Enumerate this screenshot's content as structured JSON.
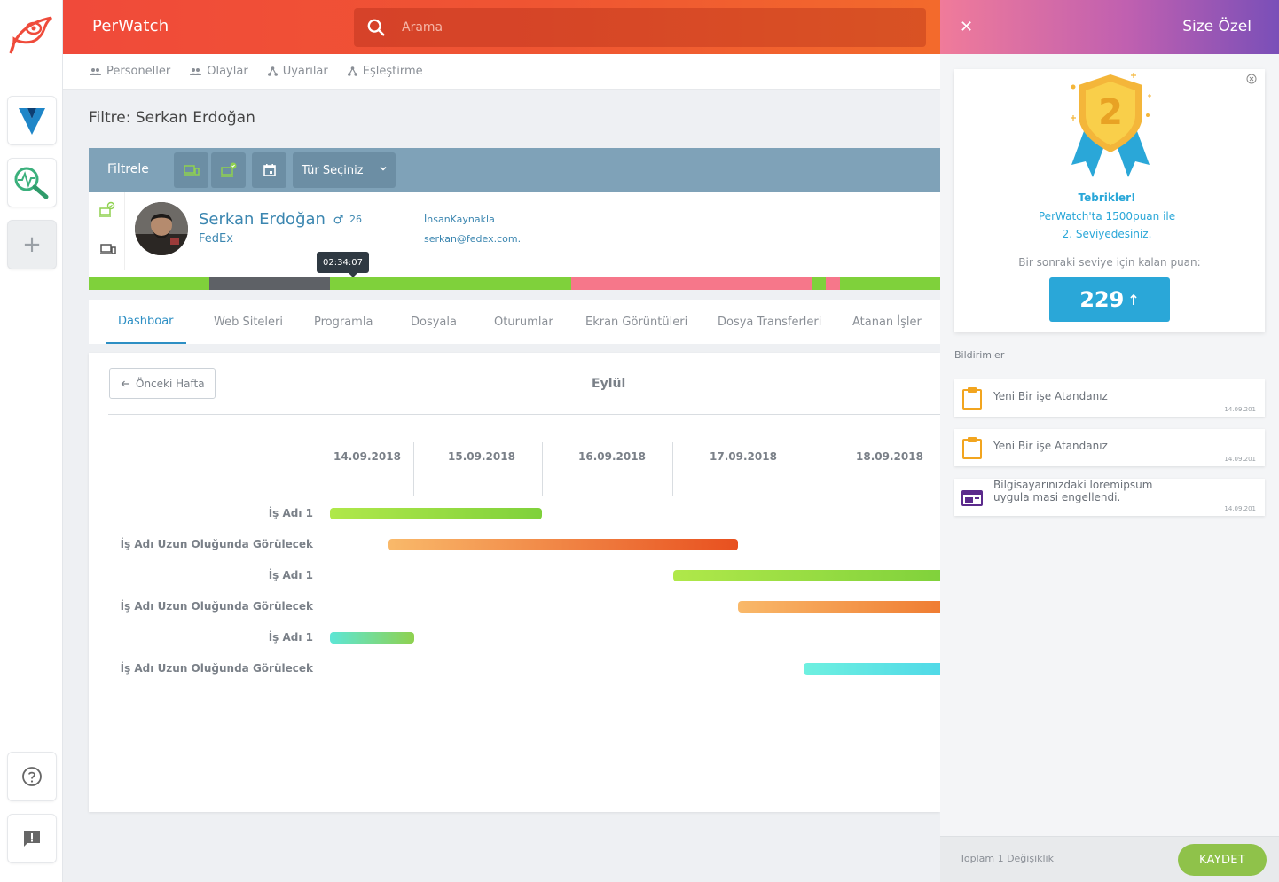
{
  "header": {
    "brand": "PerWatch",
    "search_placeholder": "Arama"
  },
  "subnav": {
    "items": [
      "Personeller",
      "Olaylar",
      "Uyarılar",
      "Eşleştirme"
    ]
  },
  "filter_title": "Filtre: Serkan Erdoğan",
  "filter_bar": {
    "label": "Filtrele",
    "type_select": "Tür Seçiniz"
  },
  "profile": {
    "name": "Serkan Erdoğan",
    "company": "FedEx",
    "age": "26",
    "department": "İnsanKaynakla",
    "email": "serkan@fedex.com.",
    "tooltip": "02:34:07"
  },
  "tabs": [
    "Dashboar",
    "Web Siteleri",
    "Programla",
    "Dosyala",
    "Oturumlar",
    "Ekran Görüntüleri",
    "Dosya Transferleri",
    "Atanan İşler"
  ],
  "dashboard": {
    "prev_button": "Önceki Hafta",
    "month": "Eylül",
    "dates": [
      "14.09.2018",
      "15.09.2018",
      "16.09.2018",
      "17.09.2018",
      "18.09.2018"
    ],
    "tasks": [
      {
        "label": "İş Adı 1"
      },
      {
        "label": "İş Adı Uzun Oluğunda Görülecek"
      },
      {
        "label": "İş Adı 1"
      },
      {
        "label": "İş Adı Uzun Oluğunda Görülecek"
      },
      {
        "label": "İş Adı 1"
      },
      {
        "label": "İş Adı Uzun Oluğunda Görülecek"
      }
    ]
  },
  "colors": {
    "header_red": "#f04a3a",
    "accent_blue": "#2aa7d8",
    "green": "#8fc24a",
    "timeline_pink": "#f6778a"
  },
  "right_panel": {
    "title": "Size Özel",
    "badge_level": "2",
    "congrats": "Tebrikler!",
    "points_line": "PerWatch'ta 1500puan  ile",
    "level_line": "2. Seviyedesiniz.",
    "next_level_label": "Bir sonraki seviye için kalan puan:",
    "remaining_points": "229",
    "notifications_title": "Bildirimler",
    "notifications": [
      {
        "text": "Yeni Bir işe Atandanız",
        "date": "14.09.201",
        "icon": "clipboard-icon"
      },
      {
        "text": "Yeni Bir işe Atandanız",
        "date": "14.09.201",
        "icon": "clipboard-icon"
      },
      {
        "text": "Bilgisayarınızdaki loremipsum uygula masi engellendi.",
        "date": "14.09.201",
        "icon": "blocked-window-icon"
      }
    ],
    "footer_count": "Toplam 1 Değişiklik",
    "save_button": "KAYDET"
  }
}
